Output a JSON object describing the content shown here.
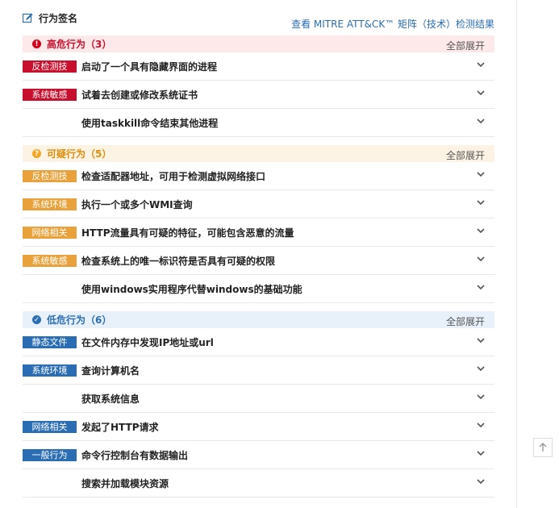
{
  "header": {
    "title": "行为签名",
    "mitre_link": "查看 MITRE ATT&CK™ 矩阵（技术）检测结果"
  },
  "sections": [
    {
      "title": "高危行为（3）",
      "expand_label": "全部展开",
      "rows": [
        {
          "tag": "反检测技",
          "text": "启动了一个具有隐藏界面的进程"
        },
        {
          "tag": "系统敏感",
          "text": "试着去创建或修改系统证书"
        },
        {
          "tag": "",
          "text": "使用taskkill命令结束其他进程"
        }
      ]
    },
    {
      "title": "可疑行为（5）",
      "expand_label": "全部展开",
      "rows": [
        {
          "tag": "反检测技",
          "text": "检查适配器地址，可用于检测虚拟网络接口"
        },
        {
          "tag": "系统环境",
          "text": "执行一个或多个WMI查询"
        },
        {
          "tag": "网络相关",
          "text": "HTTP流量具有可疑的特征，可能包含恶意的流量"
        },
        {
          "tag": "系统敏感",
          "text": "检查系统上的唯一标识符是否具有可疑的权限"
        },
        {
          "tag": "",
          "text": "使用windows实用程序代替windows的基础功能"
        }
      ]
    },
    {
      "title": "低危行为（6）",
      "expand_label": "全部展开",
      "rows": [
        {
          "tag": "静态文件",
          "text": "在文件内存中发现IP地址或url"
        },
        {
          "tag": "系统环境",
          "text": "查询计算机名"
        },
        {
          "tag": "",
          "text": "获取系统信息"
        },
        {
          "tag": "网络相关",
          "text": "发起了HTTP请求"
        },
        {
          "tag": "一般行为",
          "text": "命令行控制台有数据输出"
        },
        {
          "tag": "",
          "text": "搜索并加载模块资源"
        }
      ]
    }
  ],
  "colors": {
    "high": "#c8102e",
    "medium": "#e9a23b",
    "low": "#2a6db3"
  }
}
